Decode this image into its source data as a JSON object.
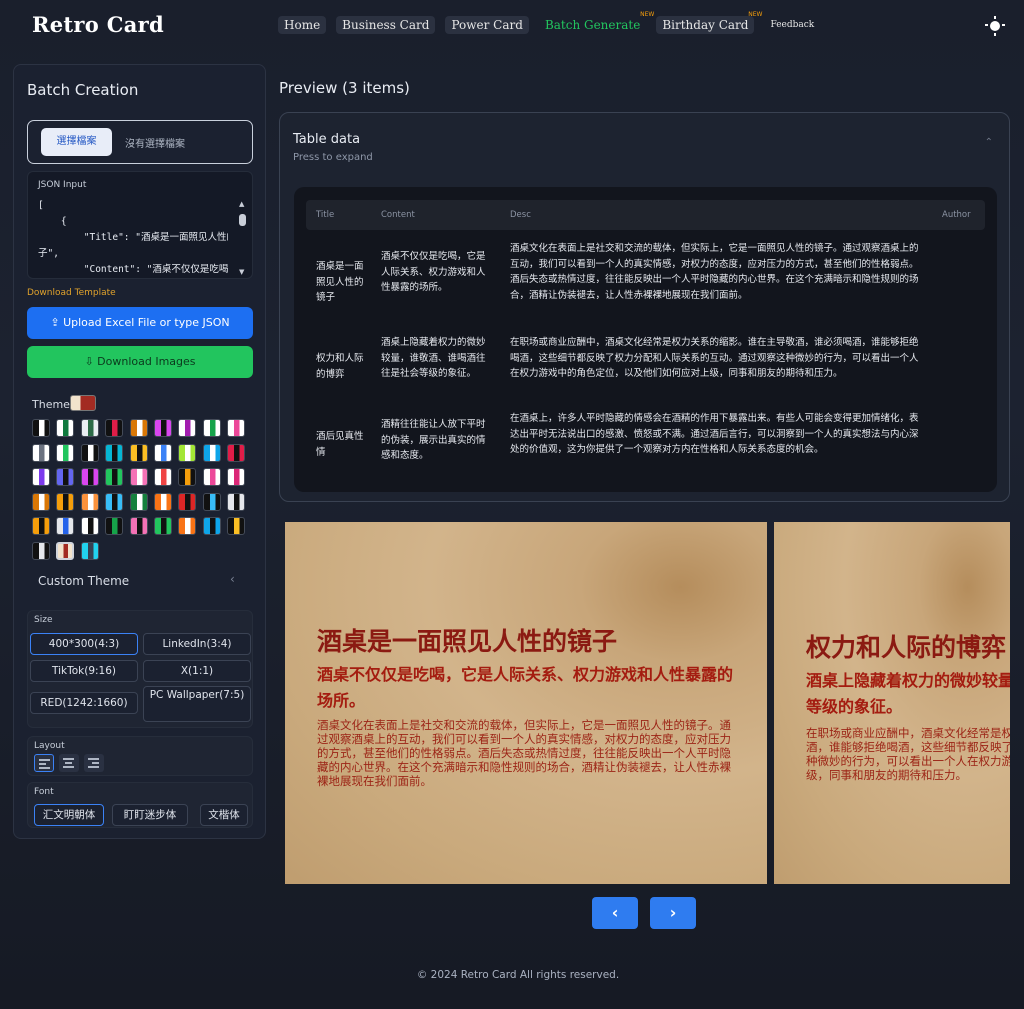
{
  "app": {
    "logo": "Retro Card"
  },
  "nav": {
    "items": [
      {
        "label": "Home"
      },
      {
        "label": "Business Card"
      },
      {
        "label": "Power Card"
      },
      {
        "label": "Batch Generate",
        "badge": "NEW"
      },
      {
        "label": "Birthday Card",
        "badge": "NEW"
      },
      {
        "label": "Feedback"
      }
    ],
    "theme_toggle_icon": "sun-icon"
  },
  "sidebar": {
    "title": "Batch Creation",
    "file_button": "選擇檔案",
    "file_status": "沒有選擇檔案",
    "json_label": "JSON Input",
    "json_text": "[\n    {\n        \"Title\": \"酒桌是一面照见人性的镜\n子\",\n        \"Content\": \"酒桌不仅仅是吃喝，",
    "download_template": "Download Template",
    "upload_button": "Upload Excel File or type JSON",
    "download_button": "Download Images",
    "theme_label": "Theme",
    "custom_theme": "Custom Theme",
    "size_label": "Size",
    "sizes": [
      {
        "label": "400*300(4:3)",
        "selected": true
      },
      {
        "label": "LinkedIn(3:4)"
      },
      {
        "label": "TikTok(9:16)"
      },
      {
        "label": "X(1:1)"
      },
      {
        "label": "RED(1242:1660)"
      },
      {
        "label": "PC Wallpaper(7:5)"
      }
    ],
    "layout_label": "Layout",
    "layouts": [
      "align-left-icon",
      "align-center-icon",
      "align-right-icon"
    ],
    "font_label": "Font",
    "fonts": [
      {
        "label": "汇文明朝体",
        "selected": true
      },
      {
        "label": "盯盯迷步体"
      },
      {
        "label": "文楷体"
      }
    ],
    "themes": [
      [
        "#111111",
        "#ffffff"
      ],
      [
        "#ffffff",
        "#0f7a3e"
      ],
      [
        "#e9eef2",
        "#2c6b47"
      ],
      [
        "#111111",
        "#e11d48"
      ],
      [
        "#d97706",
        "#ffffff"
      ],
      [
        "#d946ef",
        "#111111"
      ],
      [
        "#ffffff",
        "#a21caf"
      ],
      [
        "#ffffff",
        "#16a34a"
      ],
      [
        "#ffffff",
        "#ec4899"
      ],
      [
        "#ffffff",
        "#6b7280"
      ],
      [
        "#ffffff",
        "#22c55e"
      ],
      [
        "#111111",
        "#ffffff"
      ],
      [
        "#06b6d4",
        "#111111"
      ],
      [
        "#fbbf24",
        "#111111"
      ],
      [
        "#ffffff",
        "#3b82f6"
      ],
      [
        "#a3e635",
        "#ffffff"
      ],
      [
        "#0ea5e9",
        "#ffffff"
      ],
      [
        "#e11d48",
        "#111111"
      ],
      [
        "#ffffff",
        "#7c3aed"
      ],
      [
        "#6366f1",
        "#111111"
      ],
      [
        "#d946ef",
        "#111111"
      ],
      [
        "#22c55e",
        "#111111"
      ],
      [
        "#f472b6",
        "#ffffff"
      ],
      [
        "#ffffff",
        "#ef4444"
      ],
      [
        "#111111",
        "#f59e0b"
      ],
      [
        "#ffffff",
        "#ec4899"
      ],
      [
        "#ffffff",
        "#db2777"
      ],
      [
        "#d97706",
        "#ffffff"
      ],
      [
        "#f59e0b",
        "#111111"
      ],
      [
        "#fb923c",
        "#ffffff"
      ],
      [
        "#38bdf8",
        "#111111"
      ],
      [
        "#15803d",
        "#ffffff"
      ],
      [
        "#f97316",
        "#ffffff"
      ],
      [
        "#dc2626",
        "#111111"
      ],
      [
        "#111111",
        "#38bdf8"
      ],
      [
        "#e5e7eb",
        "#111111"
      ],
      [
        "#f59e0b",
        "#111111"
      ],
      [
        "#e5e7eb",
        "#2563eb"
      ],
      [
        "#ffffff",
        "#111111"
      ],
      [
        "#111111",
        "#16a34a"
      ],
      [
        "#f472b6",
        "#111111"
      ],
      [
        "#22c55e",
        "#111111"
      ],
      [
        "#f97316",
        "#ffffff"
      ],
      [
        "#0ea5e9",
        "#111111"
      ],
      [
        "#111111",
        "#fbbf24"
      ],
      [
        "#111111",
        "#e5e7eb"
      ],
      [
        "#f2e3cc",
        "#a32b22"
      ],
      [
        "#22d3ee",
        "#374151"
      ]
    ]
  },
  "preview": {
    "title": "Preview (3 items)",
    "table_title": "Table data",
    "table_subtitle": "Press to expand",
    "columns": [
      "Title",
      "Content",
      "Desc",
      "Author"
    ],
    "rows": [
      {
        "title": "酒桌是一面照见人性的镜子",
        "content": "酒桌不仅仅是吃喝，它是人际关系、权力游戏和人性暴露的场所。",
        "desc": "酒桌文化在表面上是社交和交流的载体，但实际上，它是一面照见人性的镜子。通过观察酒桌上的互动，我们可以看到一个人的真实情感，对权力的态度，应对压力的方式，甚至他们的性格弱点。酒后失态或热情过度，往往能反映出一个人平时隐藏的内心世界。在这个充满暗示和隐性规则的场合，酒精让伪装褪去，让人性赤裸裸地展现在我们面前。",
        "author": ""
      },
      {
        "title": "权力和人际的博弈",
        "content": "酒桌上隐藏着权力的微妙较量，谁敬酒、谁喝酒往往是社会等级的象征。",
        "desc": "在职场或商业应酬中，酒桌文化经常是权力关系的缩影。谁在主导敬酒，谁必须喝酒，谁能够拒绝喝酒，这些细节都反映了权力分配和人际关系的互动。通过观察这种微妙的行为，可以看出一个人在权力游戏中的角色定位，以及他们如何应对上级，同事和朋友的期待和压力。",
        "author": ""
      },
      {
        "title": "酒后见真性情",
        "content": "酒精往往能让人放下平时的伪装，展示出真实的情感和态度。",
        "desc": "在酒桌上，许多人平时隐藏的情感会在酒精的作用下暴露出来。有些人可能会变得更加情绪化，表达出平时无法说出口的感激、愤怒或不满。通过酒后言行，可以洞察到一个人的真实想法与内心深处的价值观，这为你提供了一个观察对方内在性格和人际关系态度的机会。",
        "author": ""
      }
    ],
    "cards": [
      {
        "title": "酒桌是一面照见人性的镜子",
        "content": "酒桌不仅仅是吃喝，它是人际关系、权力游戏和人性暴露的场所。",
        "desc": "酒桌文化在表面上是社交和交流的载体，但实际上，它是一面照见人性的镜子。通过观察酒桌上的互动，我们可以看到一个人的真实情感，对权力的态度，应对压力的方式，甚至他们的性格弱点。酒后失态或热情过度，往往能反映出一个人平时隐藏的内心世界。在这个充满暗示和隐性规则的场合，酒精让伪装褪去，让人性赤裸裸地展现在我们面前。"
      },
      {
        "title": "权力和人际的博弈",
        "content": "酒桌上隐藏着权力的微妙较量，谁敬酒、谁喝酒往往是社会等级的象征。",
        "desc": "在职场或商业应酬中，酒桌文化经常是权力关系的缩影。谁在主导敬酒，谁必须喝酒，谁能够拒绝喝酒，这些细节都反映了权力分配和人际关系的互动。通过观察这种微妙的行为，可以看出一个人在权力游戏中的角色定位，以及他们如何应对上级，同事和朋友的期待和压力。"
      }
    ],
    "prev_icon": "chevron-left-icon",
    "next_icon": "chevron-right-icon"
  },
  "footer": {
    "text": "© 2024 Retro Card All rights reserved."
  }
}
